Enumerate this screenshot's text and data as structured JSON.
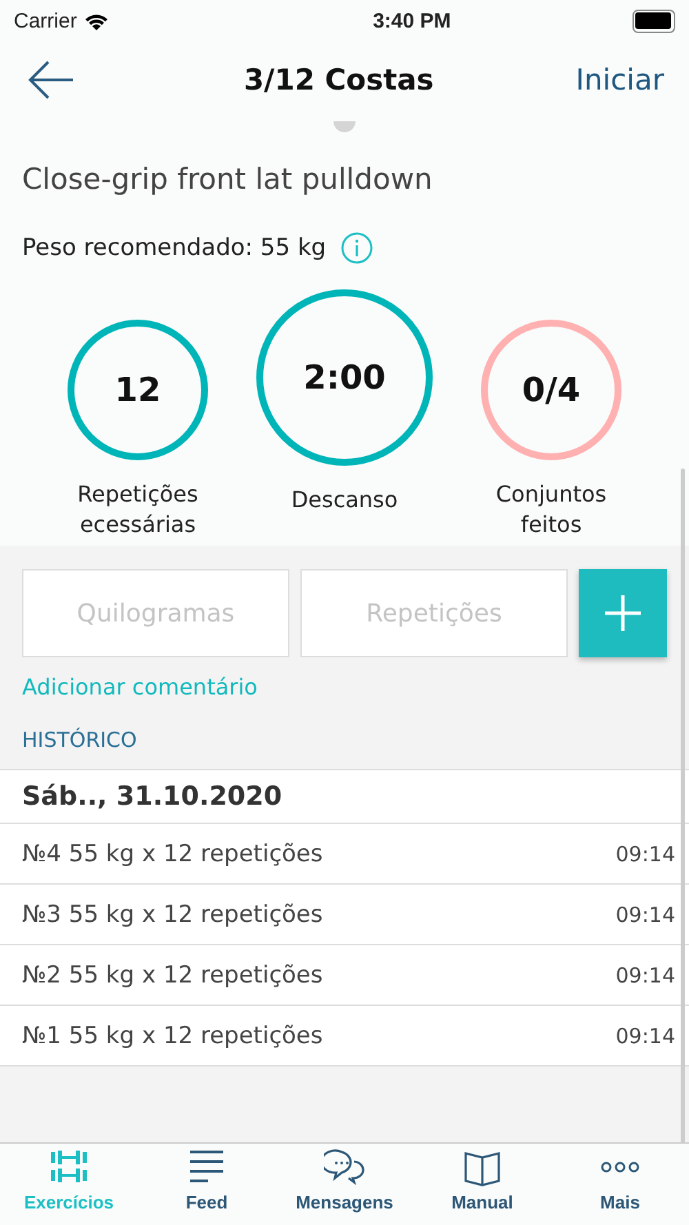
{
  "status_bar": {
    "carrier": "Carrier",
    "time": "3:40 PM"
  },
  "nav": {
    "title": "3/12 Costas",
    "action": "Iniciar"
  },
  "exercise": {
    "name": "Close-grip front lat pulldown",
    "recommended": "Peso recomendado: 55 kg"
  },
  "stats": [
    {
      "value": "12",
      "label": "Repetições ecessárias",
      "kind": "counter",
      "color": "#00b5b8"
    },
    {
      "value": "2:00",
      "label": "Descanso",
      "kind": "timer",
      "color": "#00b5b8"
    },
    {
      "value": "0/4",
      "label": "Conjuntos feitos",
      "kind": "counter",
      "color": "#ffb0b0"
    }
  ],
  "inputs": [
    {
      "placeholder": "Quilogramas"
    },
    {
      "placeholder": "Repetições"
    }
  ],
  "add_comment": "Adicionar comentário",
  "history": {
    "heading": "HISTÓRICO",
    "date": "Sáb.., 31.10.2020",
    "entries": [
      {
        "text": "№4 55 kg x 12 repetições",
        "time": "09:14"
      },
      {
        "text": "№3 55 kg x 12 repetições",
        "time": "09:14"
      },
      {
        "text": "№2 55 kg x 12 repetições",
        "time": "09:14"
      },
      {
        "text": "№1 55 kg x 12 repetições",
        "time": "09:14"
      }
    ]
  },
  "tab_bar": [
    {
      "label": "Exercícios",
      "selected": true
    },
    {
      "label": "Feed",
      "selected": false
    },
    {
      "label": "Mensagens",
      "selected": false
    },
    {
      "label": "Manual",
      "selected": false
    },
    {
      "label": "Mais",
      "selected": false
    }
  ]
}
